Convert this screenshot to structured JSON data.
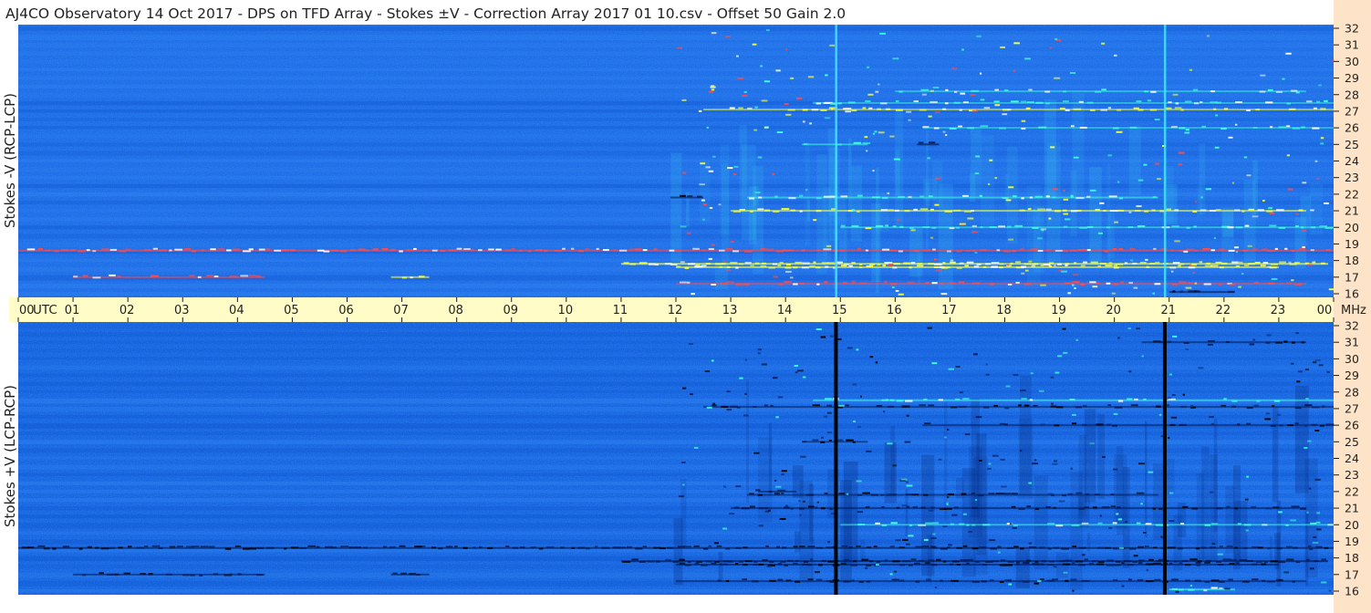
{
  "title": "AJ4CO Observatory  14 Oct 2017  -  DPS on TFD Array  -  Stokes ±V  -  Correction Array 2017 01 10.csv  -  Offset 50  Gain 2.0",
  "colors": {
    "background_blue": "#1e6be6",
    "axis_band": "#fffcc8",
    "right_axis_band": "#fde3c7",
    "tick": "#1a1a1a",
    "label": "#222222",
    "bright_signal": "#f8ff3c",
    "hot_signal": "#ff4b4b",
    "cyan_signal": "#40ffe0",
    "dark_signal": "#001a55"
  },
  "chart_data": [
    {
      "type": "heatmap",
      "panel": "top",
      "ylabel": "Stokes -V (RCP-LCP)",
      "xlabel": "UTC",
      "x_ticks": [
        "00",
        "01",
        "02",
        "03",
        "04",
        "05",
        "06",
        "07",
        "08",
        "09",
        "10",
        "11",
        "12",
        "13",
        "14",
        "15",
        "16",
        "17",
        "18",
        "19",
        "20",
        "21",
        "22",
        "23",
        "00"
      ],
      "y_ticks": [
        "32",
        "31",
        "30",
        "29",
        "28",
        "27",
        "26",
        "25",
        "24",
        "23",
        "22",
        "21",
        "20",
        "19",
        "18",
        "17",
        "16"
      ],
      "x_range": [
        0,
        24
      ],
      "y_range": [
        16,
        32
      ],
      "y_unit": "MHz",
      "vertical_lines_utc": [
        14.92,
        20.92
      ],
      "vertical_line_color": "#40e8ff",
      "signals": [
        {
          "freq": 18.6,
          "start": 0.0,
          "end": 24.0,
          "strength": 0.9,
          "color": "hot"
        },
        {
          "freq": 17.0,
          "start": 1.0,
          "end": 4.5,
          "strength": 0.65,
          "color": "hot"
        },
        {
          "freq": 17.0,
          "start": 6.8,
          "end": 7.5,
          "strength": 0.7,
          "color": "yellow"
        },
        {
          "freq": 17.8,
          "start": 11.0,
          "end": 23.9,
          "strength": 1.0,
          "color": "yellow"
        },
        {
          "freq": 17.6,
          "start": 12.0,
          "end": 23.0,
          "strength": 0.8,
          "color": "yellow"
        },
        {
          "freq": 16.6,
          "start": 12.0,
          "end": 23.5,
          "strength": 0.6,
          "color": "hot"
        },
        {
          "freq": 21.0,
          "start": 13.0,
          "end": 23.5,
          "strength": 0.7,
          "color": "yellow"
        },
        {
          "freq": 21.8,
          "start": 13.3,
          "end": 20.8,
          "strength": 0.6,
          "color": "cyan"
        },
        {
          "freq": 20.0,
          "start": 15.0,
          "end": 24.0,
          "strength": 0.6,
          "color": "cyan"
        },
        {
          "freq": 27.1,
          "start": 12.5,
          "end": 24.0,
          "strength": 0.55,
          "color": "yellow"
        },
        {
          "freq": 27.5,
          "start": 14.5,
          "end": 24.0,
          "strength": 0.5,
          "color": "cyan"
        },
        {
          "freq": 26.0,
          "start": 16.5,
          "end": 24.0,
          "strength": 0.45,
          "color": "cyan"
        },
        {
          "freq": 25.0,
          "start": 14.3,
          "end": 15.5,
          "strength": 0.6,
          "color": "cyan"
        },
        {
          "freq": 28.2,
          "start": 16.0,
          "end": 23.5,
          "strength": 0.4,
          "color": "cyan"
        },
        {
          "freq": 16.1,
          "start": 21.0,
          "end": 22.2,
          "strength": 0.8,
          "color": "dark"
        },
        {
          "freq": 25.0,
          "start": 16.4,
          "end": 16.8,
          "strength": 0.8,
          "color": "dark"
        },
        {
          "freq": 21.8,
          "start": 11.9,
          "end": 12.5,
          "strength": 0.7,
          "color": "dark"
        }
      ]
    },
    {
      "type": "heatmap",
      "panel": "bottom",
      "ylabel": "Stokes +V (LCP-RCP)",
      "xlabel": "UTC",
      "x_ticks": [
        "00",
        "01",
        "02",
        "03",
        "04",
        "05",
        "06",
        "07",
        "08",
        "09",
        "10",
        "11",
        "12",
        "13",
        "14",
        "15",
        "16",
        "17",
        "18",
        "19",
        "20",
        "21",
        "22",
        "23",
        "00"
      ],
      "y_ticks": [
        "32",
        "31",
        "30",
        "29",
        "28",
        "27",
        "26",
        "25",
        "24",
        "23",
        "22",
        "21",
        "20",
        "19",
        "18",
        "17",
        "16"
      ],
      "x_range": [
        0,
        24
      ],
      "y_range": [
        16,
        32
      ],
      "y_unit": "MHz",
      "vertical_lines_utc": [
        14.92,
        20.92
      ],
      "vertical_line_color": "#000000",
      "signals": [
        {
          "freq": 18.6,
          "start": 0.0,
          "end": 24.0,
          "strength": 0.9,
          "color": "dark"
        },
        {
          "freq": 17.0,
          "start": 1.0,
          "end": 4.5,
          "strength": 0.65,
          "color": "dark"
        },
        {
          "freq": 17.0,
          "start": 6.8,
          "end": 7.5,
          "strength": 0.7,
          "color": "dark"
        },
        {
          "freq": 17.8,
          "start": 11.0,
          "end": 23.9,
          "strength": 1.0,
          "color": "dark"
        },
        {
          "freq": 17.6,
          "start": 12.0,
          "end": 23.0,
          "strength": 0.8,
          "color": "dark"
        },
        {
          "freq": 16.6,
          "start": 12.0,
          "end": 23.5,
          "strength": 0.6,
          "color": "dark"
        },
        {
          "freq": 21.0,
          "start": 13.0,
          "end": 23.5,
          "strength": 0.6,
          "color": "dark"
        },
        {
          "freq": 21.8,
          "start": 13.3,
          "end": 20.8,
          "strength": 0.5,
          "color": "dark"
        },
        {
          "freq": 20.0,
          "start": 15.0,
          "end": 24.0,
          "strength": 0.55,
          "color": "cyan"
        },
        {
          "freq": 27.1,
          "start": 12.5,
          "end": 24.0,
          "strength": 0.55,
          "color": "dark"
        },
        {
          "freq": 27.5,
          "start": 14.5,
          "end": 24.0,
          "strength": 0.5,
          "color": "cyan"
        },
        {
          "freq": 26.0,
          "start": 16.5,
          "end": 24.0,
          "strength": 0.45,
          "color": "dark"
        },
        {
          "freq": 25.0,
          "start": 14.3,
          "end": 15.5,
          "strength": 0.6,
          "color": "dark"
        },
        {
          "freq": 31.0,
          "start": 20.5,
          "end": 23.5,
          "strength": 0.5,
          "color": "dark"
        },
        {
          "freq": 16.1,
          "start": 21.0,
          "end": 22.2,
          "strength": 0.8,
          "color": "cyan"
        },
        {
          "freq": 22.0,
          "start": 13.5,
          "end": 14.2,
          "strength": 0.7,
          "color": "dark"
        }
      ]
    }
  ]
}
